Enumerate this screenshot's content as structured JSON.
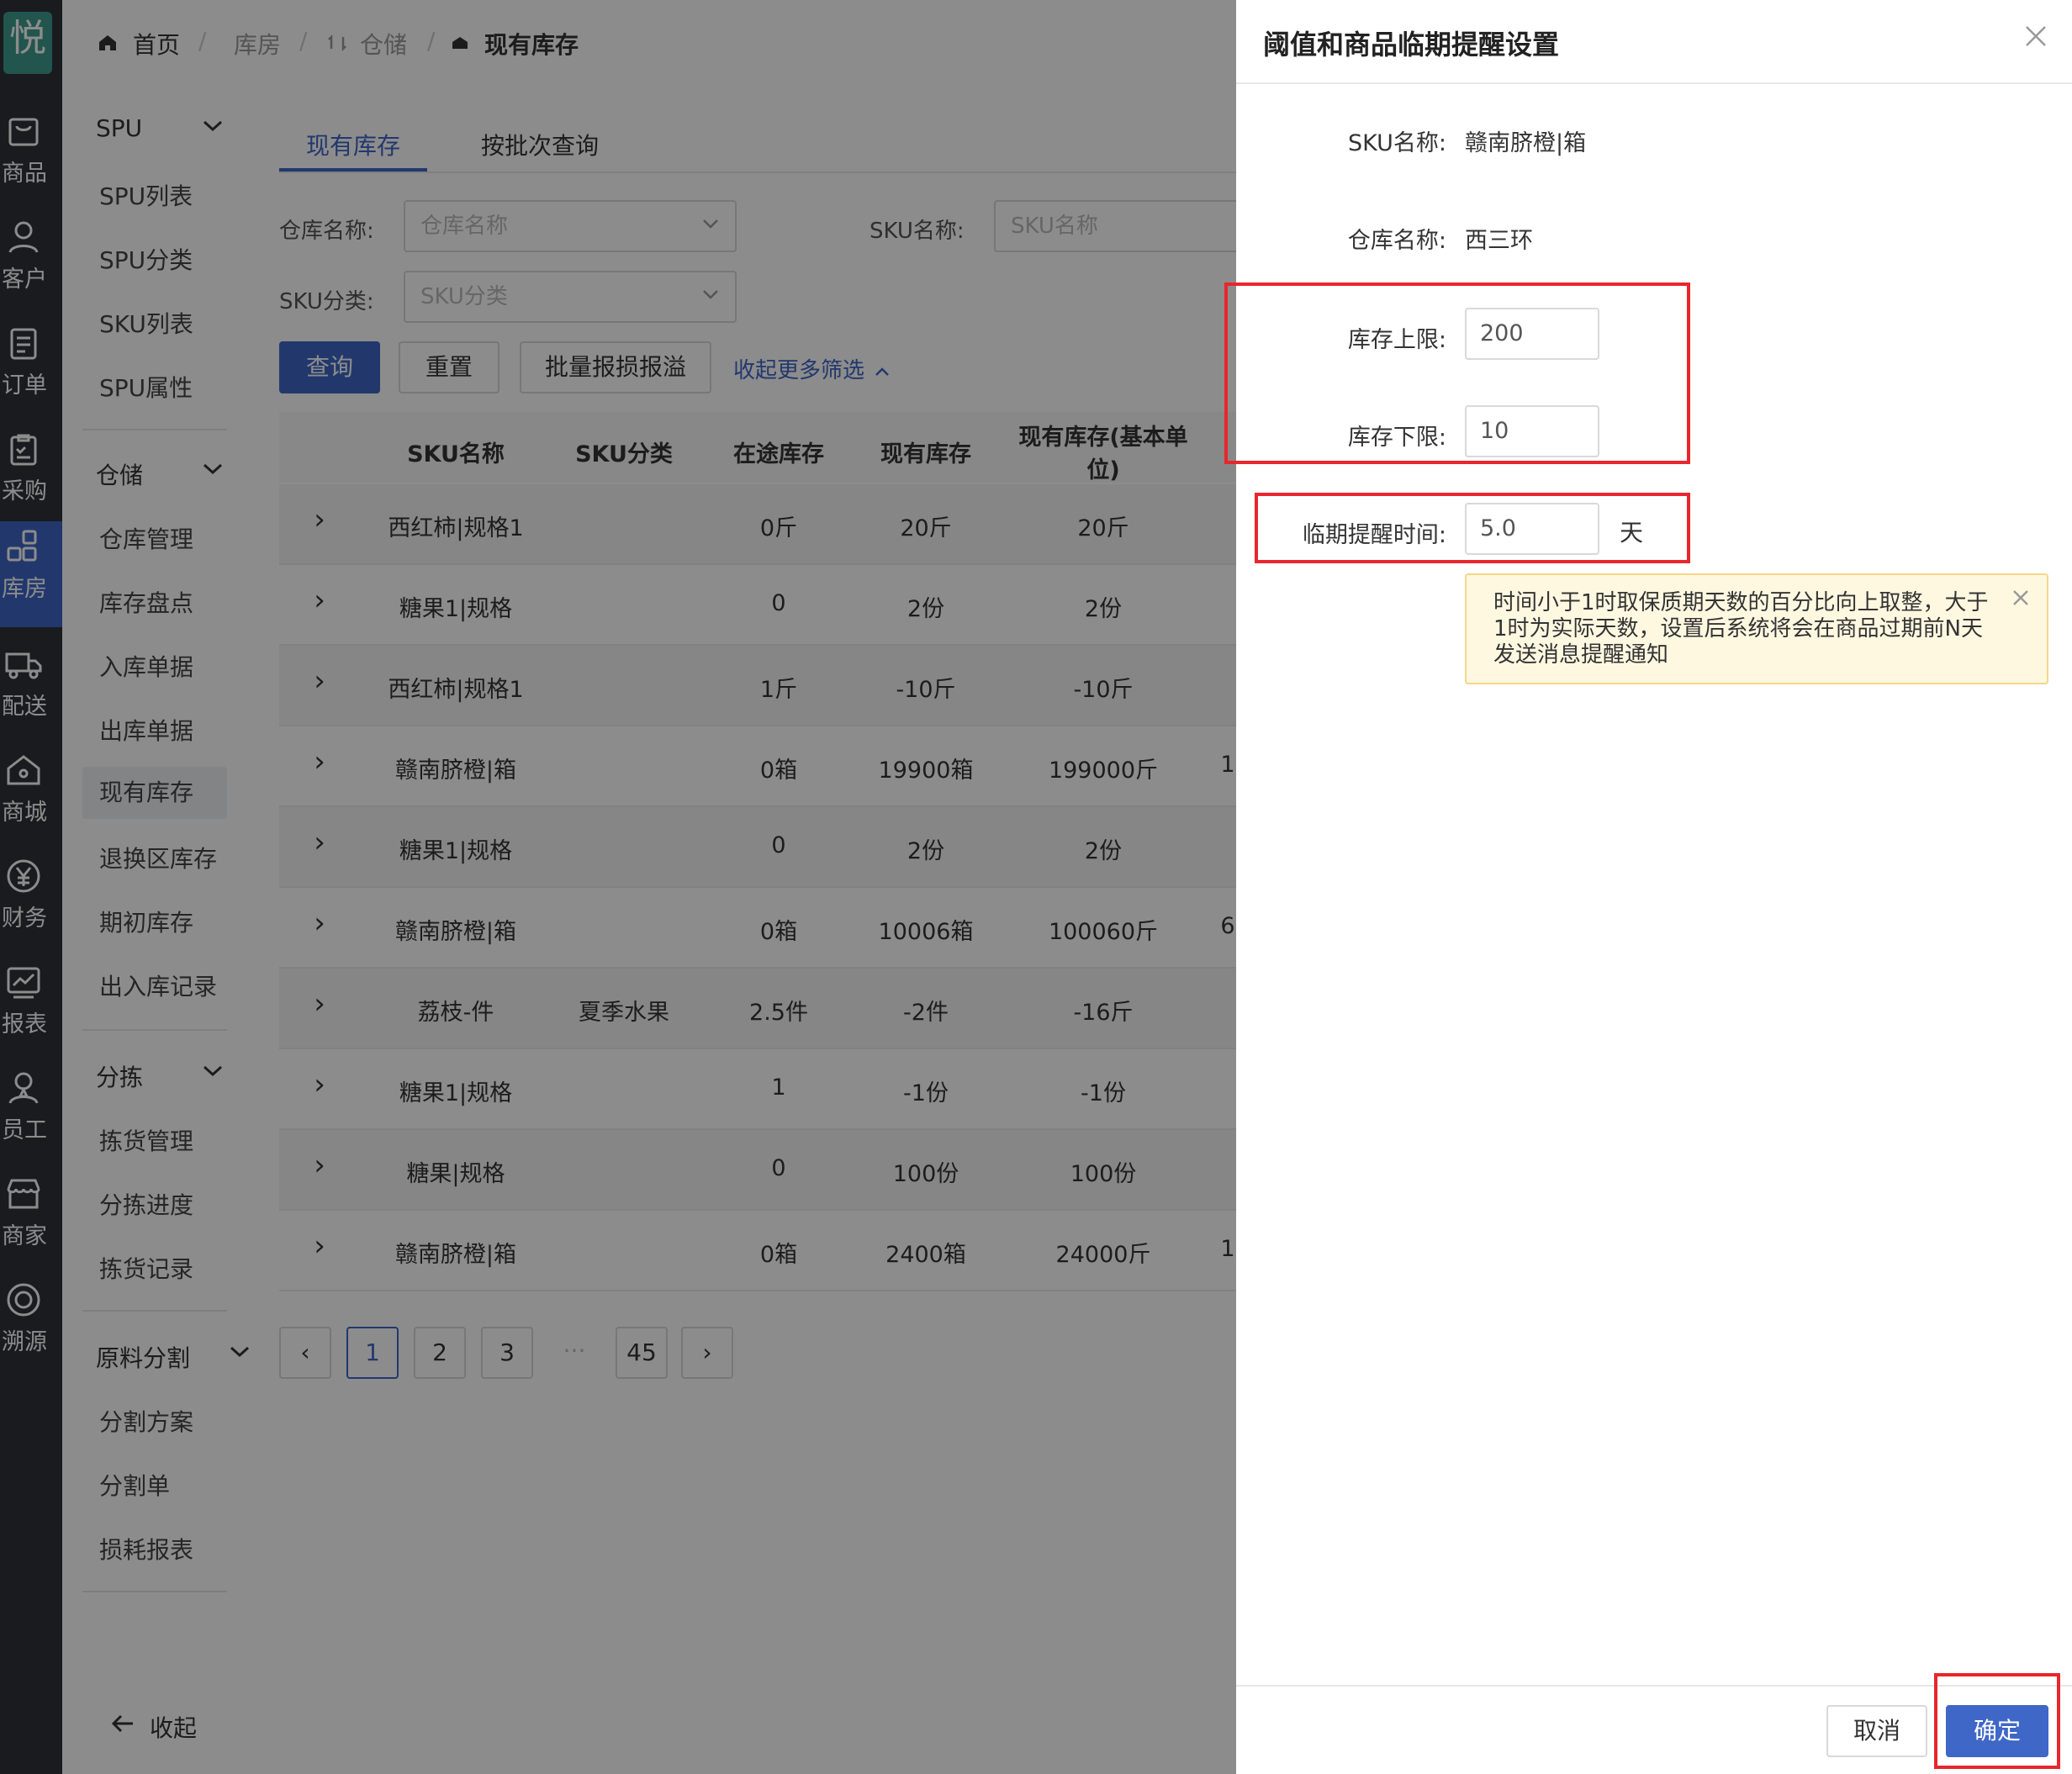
{
  "rail": {
    "logo": "悦",
    "items": [
      {
        "label": "商品",
        "icon": "bag-icon"
      },
      {
        "label": "客户",
        "icon": "user-icon"
      },
      {
        "label": "订单",
        "icon": "document-icon"
      },
      {
        "label": "采购",
        "icon": "clipboard-icon"
      },
      {
        "label": "库房",
        "icon": "grid-icon"
      },
      {
        "label": "配送",
        "icon": "truck-icon"
      },
      {
        "label": "商城",
        "icon": "home-icon"
      },
      {
        "label": "财务",
        "icon": "yen-icon"
      },
      {
        "label": "报表",
        "icon": "chart-icon"
      },
      {
        "label": "员工",
        "icon": "staff-icon"
      },
      {
        "label": "商家",
        "icon": "store-icon"
      },
      {
        "label": "溯源",
        "icon": "trace-icon"
      }
    ]
  },
  "breadcrumb": {
    "home": "首页",
    "level1": "库房",
    "level2": "仓储",
    "level3": "现有库存"
  },
  "submenu": {
    "groups": [
      {
        "label": "SPU",
        "items": [
          "SPU列表",
          "SPU分类",
          "SKU列表",
          "SPU属性"
        ]
      },
      {
        "label": "仓储",
        "items": [
          "仓库管理",
          "库存盘点",
          "入库单据",
          "出库单据",
          "现有库存",
          "退换区库存",
          "期初库存",
          "出入库记录"
        ]
      },
      {
        "label": "分拣",
        "items": [
          "拣货管理",
          "分拣进度",
          "拣货记录"
        ]
      },
      {
        "label": "原料分割",
        "items": [
          "分割方案",
          "分割单",
          "损耗报表"
        ]
      }
    ],
    "collapse": "收起"
  },
  "tabs": [
    "现有库存",
    "按批次查询"
  ],
  "filters": {
    "warehouse_label": "仓库名称:",
    "warehouse_placeholder": "仓库名称",
    "sku_name_label": "SKU名称:",
    "sku_name_placeholder": "SKU名称",
    "sku_cat_label": "SKU分类:",
    "sku_cat_placeholder": "SKU分类",
    "query": "查询",
    "reset": "重置",
    "batch": "批量报损报溢",
    "more": "收起更多筛选"
  },
  "table": {
    "headers": [
      "SKU名称",
      "SKU分类",
      "在途库存",
      "现有库存",
      "现有库存(基本单",
      "位)"
    ],
    "rows": [
      {
        "name": "西红柿|规格1",
        "cat": "",
        "transit": "0斤",
        "stock": "20斤",
        "base": "20斤",
        "extra": ""
      },
      {
        "name": "糖果1|规格",
        "cat": "",
        "transit": "0",
        "stock": "2份",
        "base": "2份",
        "extra": ""
      },
      {
        "name": "西红柿|规格1",
        "cat": "",
        "transit": "1斤",
        "stock": "-10斤",
        "base": "-10斤",
        "extra": ""
      },
      {
        "name": "赣南脐橙|箱",
        "cat": "",
        "transit": "0箱",
        "stock": "19900箱",
        "base": "199000斤",
        "extra": "1"
      },
      {
        "name": "糖果1|规格",
        "cat": "",
        "transit": "0",
        "stock": "2份",
        "base": "2份",
        "extra": ""
      },
      {
        "name": "赣南脐橙|箱",
        "cat": "",
        "transit": "0箱",
        "stock": "10006箱",
        "base": "100060斤",
        "extra": "6"
      },
      {
        "name": "荔枝-件",
        "cat": "夏季水果",
        "transit": "2.5件",
        "stock": "-2件",
        "base": "-16斤",
        "extra": ""
      },
      {
        "name": "糖果1|规格",
        "cat": "",
        "transit": "1",
        "stock": "-1份",
        "base": "-1份",
        "extra": ""
      },
      {
        "name": "糖果|规格",
        "cat": "",
        "transit": "0",
        "stock": "100份",
        "base": "100份",
        "extra": ""
      },
      {
        "name": "赣南脐橙|箱",
        "cat": "",
        "transit": "0箱",
        "stock": "2400箱",
        "base": "24000斤",
        "extra": "1"
      }
    ]
  },
  "pagination": {
    "prev": "‹",
    "pages": [
      "1",
      "2",
      "3"
    ],
    "dots": "···",
    "last": "45",
    "next": "›"
  },
  "drawer": {
    "title": "阈值和商品临期提醒设置",
    "sku_name_label": "SKU名称:",
    "sku_name_value": "赣南脐橙|箱",
    "warehouse_label": "仓库名称:",
    "warehouse_value": "西三环",
    "upper_label": "库存上限:",
    "upper_value": "200",
    "lower_label": "库存下限:",
    "lower_value": "10",
    "expiry_label": "临期提醒时间:",
    "expiry_value": "5.0",
    "expiry_unit": "天",
    "tip": "时间小于1时取保质期天数的百分比向上取整，大于1时为实际天数，设置后系统将会在商品过期前N天发送消息提醒通知",
    "cancel": "取消",
    "confirm": "确定"
  },
  "colors": {
    "primary": "#3f67c7",
    "highlight": "#e8262d",
    "rail": "#2f3238",
    "tip_bg": "#fff8e1"
  }
}
